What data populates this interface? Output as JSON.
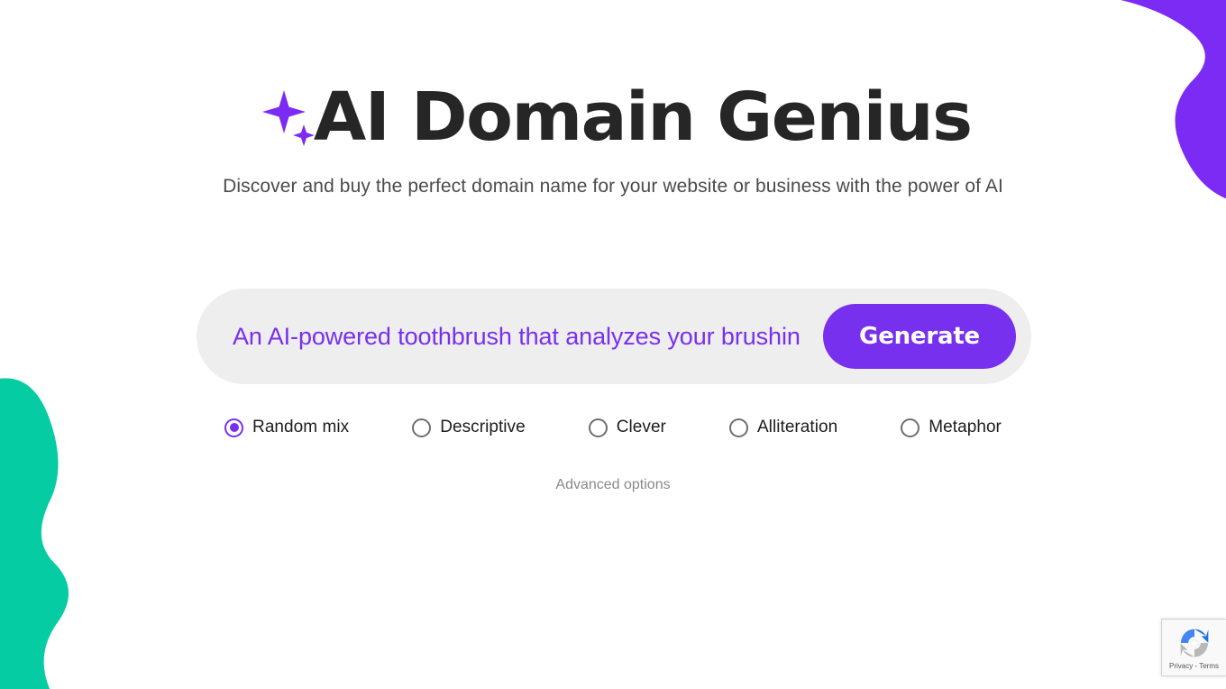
{
  "theme": {
    "accent_purple": "#7730ee",
    "blob_purple": "#7c2bf5",
    "blob_teal": "#06cca4",
    "title_color": "#262626",
    "search_bg": "#eeeeee",
    "page_bg": "#ffffff"
  },
  "hero": {
    "sparkle_icon": "sparkle-icon",
    "title": "AI Domain Genius",
    "subtitle": "Discover and buy the perfect domain name for your website or business with the power of AI"
  },
  "search": {
    "value": "An AI-powered toothbrush that analyzes your brushin",
    "placeholder": "An AI-powered toothbrush that analyzes your brushin",
    "generate_label": "Generate"
  },
  "options": {
    "selected": "Random mix",
    "items": [
      {
        "label": "Random mix",
        "selected": true
      },
      {
        "label": "Descriptive",
        "selected": false
      },
      {
        "label": "Clever",
        "selected": false
      },
      {
        "label": "Alliteration",
        "selected": false
      },
      {
        "label": "Metaphor",
        "selected": false
      }
    ]
  },
  "advanced": {
    "label": "Advanced options"
  },
  "recaptcha": {
    "logo_icon": "recaptcha-icon",
    "text": "Privacy - Terms"
  }
}
